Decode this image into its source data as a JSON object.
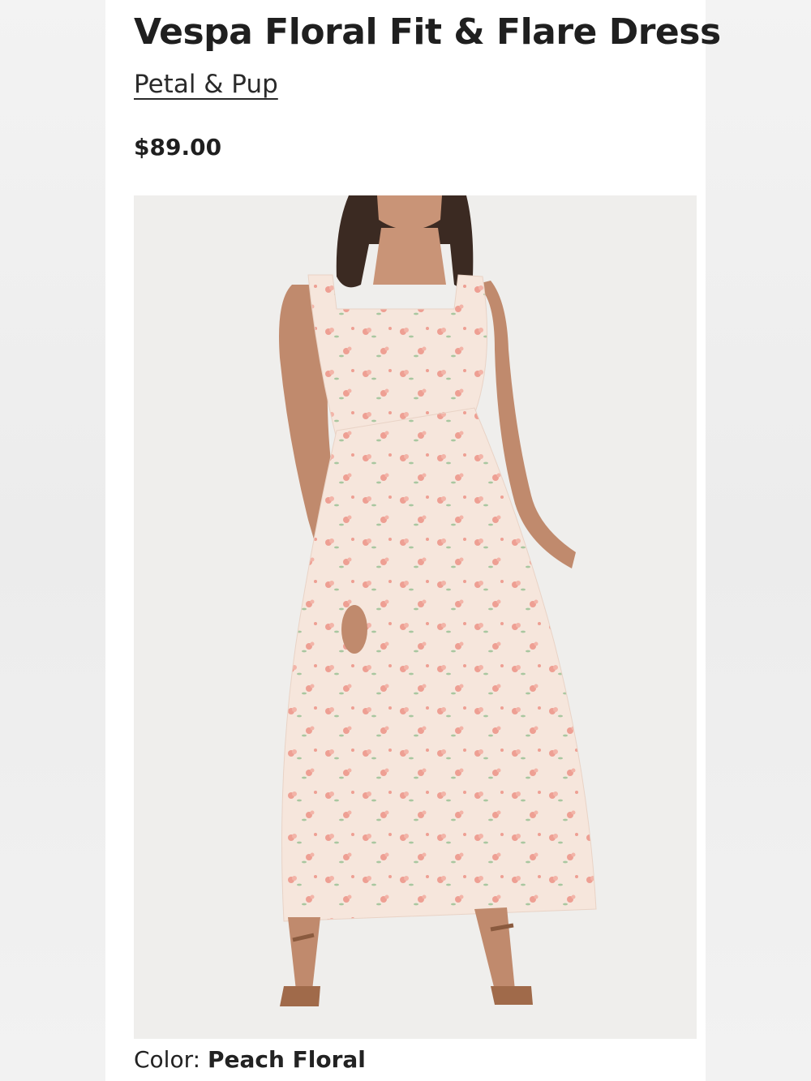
{
  "product": {
    "title": "Vespa Floral Fit & Flare Dress",
    "brand": "Petal & Pup",
    "price": "$89.00",
    "color_label": "Color:",
    "color_value": "Peach Floral"
  },
  "image": {
    "subject": "model-wearing-floral-dress",
    "background_color": "#efeeec",
    "dress_color": "#f6e6dc",
    "print_color": "#ee9f93"
  }
}
